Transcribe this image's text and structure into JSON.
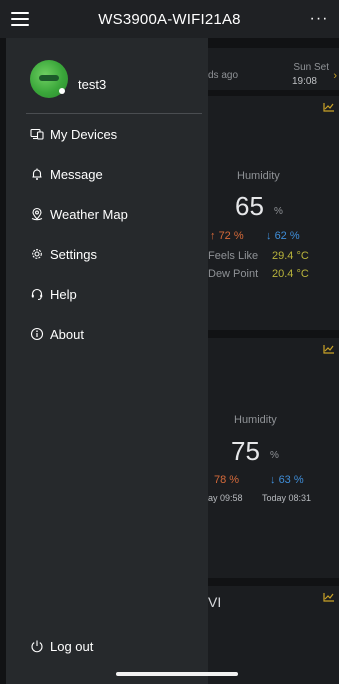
{
  "header": {
    "device_name": "WS3900A-WIFI21A8",
    "more_icon": "ellipsis-icon",
    "menu_icon": "hamburger-icon"
  },
  "drawer": {
    "username": "test3",
    "items": [
      {
        "label": "My Devices",
        "icon": "devices-icon"
      },
      {
        "label": "Message",
        "icon": "bell-icon"
      },
      {
        "label": "Weather Map",
        "icon": "map-pin-icon"
      },
      {
        "label": "Settings",
        "icon": "gear-icon"
      },
      {
        "label": "Help",
        "icon": "headset-icon"
      },
      {
        "label": "About",
        "icon": "info-icon"
      }
    ],
    "logout": {
      "label": "Log out",
      "icon": "power-icon"
    }
  },
  "dashboard": {
    "updated_fragment": "ds ago",
    "sunset": {
      "label": "Sun Set",
      "time": "19:08"
    },
    "card1": {
      "humidity_label": "Humidity",
      "humidity_value": "65",
      "humidity_unit": "%",
      "max": "72 %",
      "min": "62 %",
      "feels_like_label": "Feels Like",
      "feels_like_value": "29.4 °C",
      "dew_point_label": "Dew Point",
      "dew_point_value": "20.4 °C"
    },
    "card2": {
      "humidity_label": "Humidity",
      "humidity_value": "75",
      "humidity_unit": "%",
      "max": "78 %",
      "min": "63 %",
      "max_time": "ay 09:58",
      "min_time": "Today 08:31"
    },
    "card3": {
      "label": "VI"
    }
  },
  "colors": {
    "drawer_bg": "#26292c",
    "topbar_bg": "#1f2124",
    "accent_max": "#d66a3a",
    "accent_min": "#3f8ed9",
    "accent_yellow": "#b9b43b",
    "chart_icon": "#c9a227"
  }
}
